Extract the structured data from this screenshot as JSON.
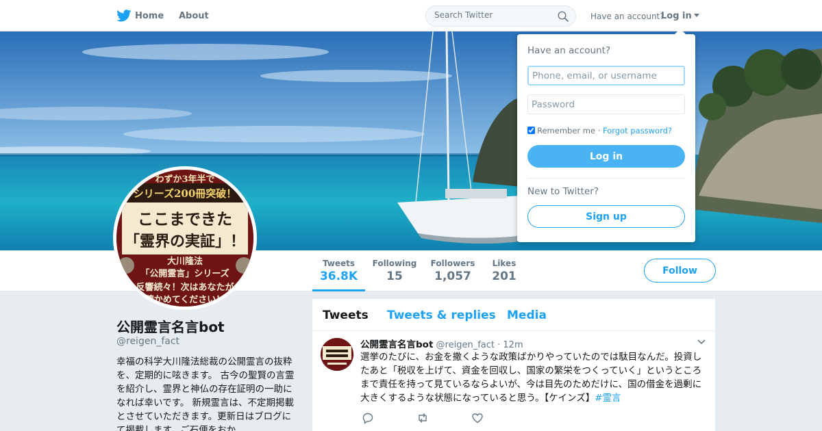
{
  "nav": {
    "home_label": "Home",
    "about_label": "About",
    "search_placeholder": "Search Twitter",
    "have_account": "Have an account?",
    "login_label": "Log in"
  },
  "profile": {
    "name": "公開霊言名言bot",
    "handle": "@reigen_fact",
    "bio": "幸福の科学大川隆法総裁の公開霊言の抜粋を、定期的に呟きます。 古今の聖賢の言霊を紹介し、霊界と神仏の存在証明の一助になれば幸いです。 新規霊言は、不定期掲載とさせていただきます。更新日はブログにて掲載します。ご石便をおか",
    "avatar_text": {
      "line1": "わずか3年半で",
      "line2": "シリーズ200冊突破！",
      "line3": "ここまできた",
      "line4": "「霊界の実証」！",
      "line5": "大川隆法",
      "line6": "「公開霊言」シリーズ",
      "line7": "反響続々！次はあなたが",
      "line8": "確かめてください！"
    }
  },
  "stats": [
    {
      "label": "Tweets",
      "value": "36.8K"
    },
    {
      "label": "Following",
      "value": "15"
    },
    {
      "label": "Followers",
      "value": "1,057"
    },
    {
      "label": "Likes",
      "value": "201"
    }
  ],
  "follow_label": "Follow",
  "tabs": [
    "Tweets",
    "Tweets & replies",
    "Media"
  ],
  "tweet": {
    "name": "公開霊言名言bot",
    "handle": "@reigen_fact",
    "time": "12m",
    "text": "選挙のたびに、お金を撒くような政策ばかりやっていたのでは駄目なんだ。投資したあと「税収を上げて、資金を回収し、国家の繁栄をつくっていく」というところまで責任を持って見ているならよいが、今は目先のためだけに、国の借金を過剰に大きくするような状態になっていると思う。【ケインズ】",
    "hashtag": "#霊言"
  },
  "login_dropdown": {
    "title": "Have an account?",
    "username_placeholder": "Phone, email, or username",
    "password_placeholder": "Password",
    "remember_label": "Remember me",
    "separator": " · ",
    "forgot_label": "Forgot password?",
    "login_button": "Log in",
    "new_label": "New to Twitter?",
    "signup_button": "Sign up"
  },
  "colors": {
    "accent": "#1da1f2",
    "login_button": "#4ab3f4",
    "background": "#e6ecf0"
  }
}
